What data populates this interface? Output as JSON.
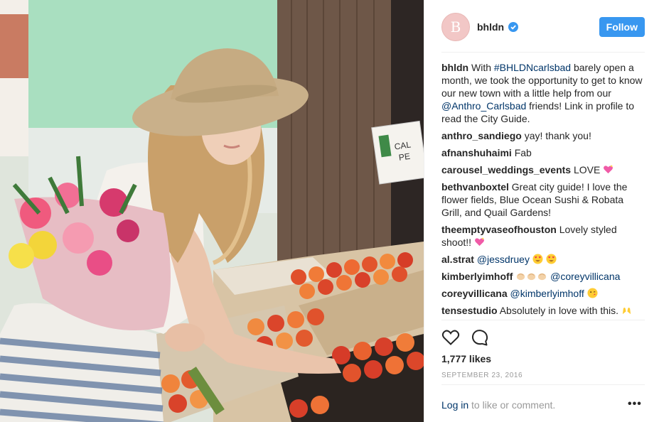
{
  "post": {
    "username": "bhldn",
    "avatar_letter": "B",
    "follow_label": "Follow",
    "caption": {
      "username": "bhldn",
      "parts": [
        "With ",
        "#BHLDNcarlsbad",
        " barely open a month, we took the opportunity to get to know our new town with a little help from our ",
        "@Anthro_Carlsbad",
        " friends! Link in profile to read the City Guide."
      ]
    },
    "likes": "1,777 likes",
    "date": "SEPTEMBER 23, 2016",
    "login_link": "Log in",
    "login_text": " to like or comment.",
    "more_label": "•••"
  },
  "comments": [
    {
      "user": "anthro_sandiego",
      "text": "yay! thank you!"
    },
    {
      "user": "afnanshuhaimi",
      "text": "Fab"
    },
    {
      "user": "carousel_weddings_events",
      "text": "LOVE",
      "emoji": "sparkling-heart-icon"
    },
    {
      "user": "bethvanboxtel",
      "text": "Great city guide! I love the flower fields, Blue Ocean Sushi & Robata Grill, and Quail Gardens!"
    },
    {
      "user": "theemptyvaseofhouston",
      "text": "Lovely styled shoot!!",
      "emoji": "sparkling-heart-icon"
    },
    {
      "user": "al.strat",
      "mention": "@jessdruey",
      "emoji": "heart-eyes-icon x2"
    },
    {
      "user": "kimberlyimhoff",
      "mention": "@coreyvillicana",
      "emoji": "clapping-hands-icon x3"
    },
    {
      "user": "coreyvillicana",
      "mention": "@kimberlyimhoff",
      "emoji": "kissing-face-icon"
    },
    {
      "user": "tensestudio",
      "text": "Absolutely in love with this.",
      "emoji": "raised-hands-icon"
    }
  ],
  "colors": {
    "accent": "#3897f0",
    "link": "#003569",
    "muted": "#999999",
    "avatar": "#f2c7c6"
  }
}
